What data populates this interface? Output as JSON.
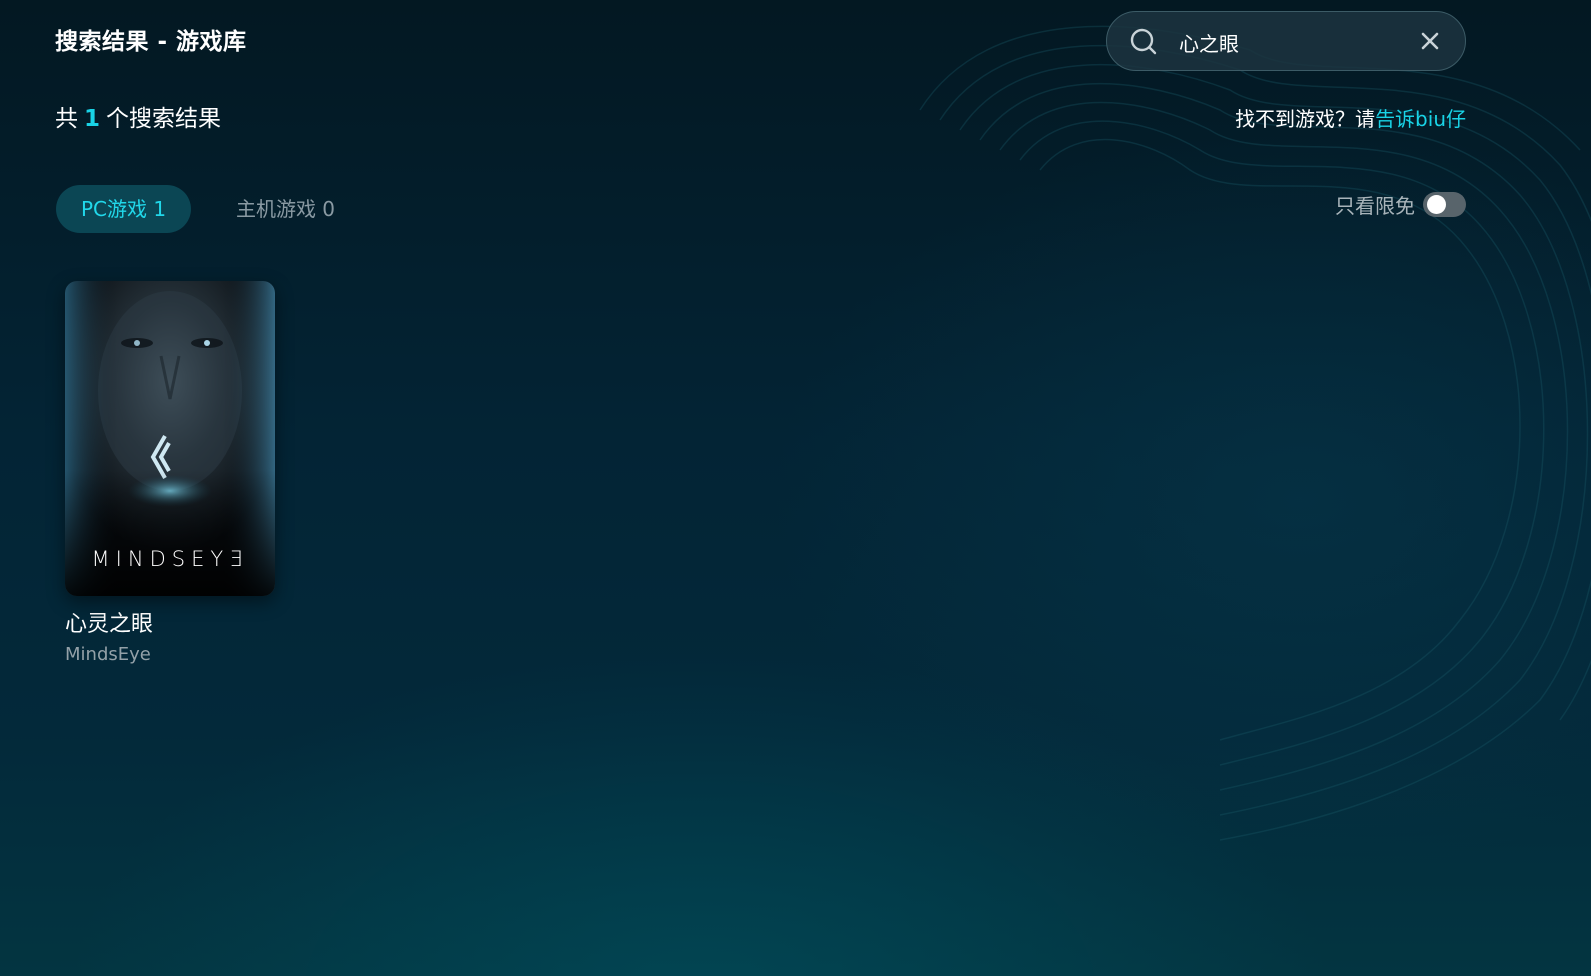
{
  "header": {
    "title": "搜索结果 - 游戏库"
  },
  "search": {
    "value": "心之眼",
    "icon": "search-icon",
    "clear_icon": "close-icon"
  },
  "results": {
    "prefix": "共",
    "count": "1",
    "suffix": "个搜索结果"
  },
  "feedback": {
    "text": "找不到游戏？请",
    "link": "告诉biu仔"
  },
  "tabs": [
    {
      "label": "PC游戏 1",
      "active": true
    },
    {
      "label": "主机游戏 0",
      "active": false
    }
  ],
  "filter": {
    "label": "只看限免",
    "on": false
  },
  "games": [
    {
      "name": "心灵之眼",
      "en_name": "MindsEye",
      "cover_text": "MINDSEYƎ"
    }
  ],
  "colors": {
    "accent": "#19d3e6",
    "background": "#031d2b",
    "tab_active_bg": "#0b4654"
  }
}
